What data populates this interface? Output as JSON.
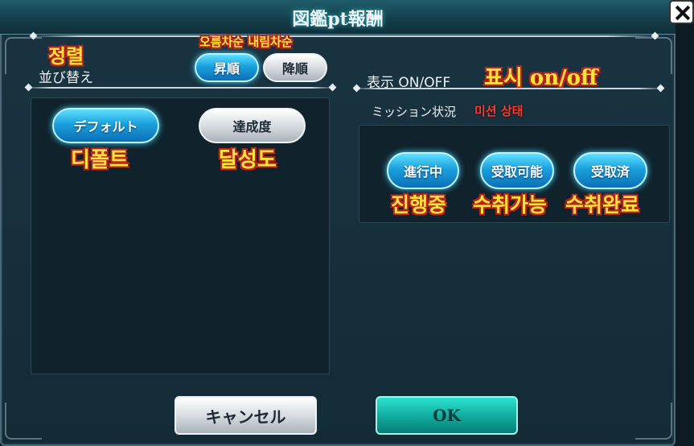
{
  "dialog": {
    "title": "図鑑pt報酬"
  },
  "sort": {
    "label": "並び替え",
    "label_kr": "정렬",
    "order_kr": "오름차순  내림차순",
    "ascending": "昇順",
    "descending": "降順",
    "default_btn": "デフォルト",
    "default_kr": "디폴트",
    "achievement_btn": "達成度",
    "achievement_kr": "달성도"
  },
  "display": {
    "label": "表示 ON/OFF",
    "label_kr": "표시 on/off",
    "mission_label": "ミッション状況",
    "mission_kr": "미션 상태",
    "in_progress": "進行中",
    "in_progress_kr": "진행중",
    "claimable": "受取可能",
    "claimable_kr": "수취가능",
    "claimed": "受取済",
    "claimed_kr": "수취완료"
  },
  "footer": {
    "cancel": "キャンセル",
    "ok": "OK"
  },
  "colors": {
    "accent": "#1aa0dd",
    "annotation": "#ffe23a",
    "annotation_outline": "#b8231c"
  }
}
